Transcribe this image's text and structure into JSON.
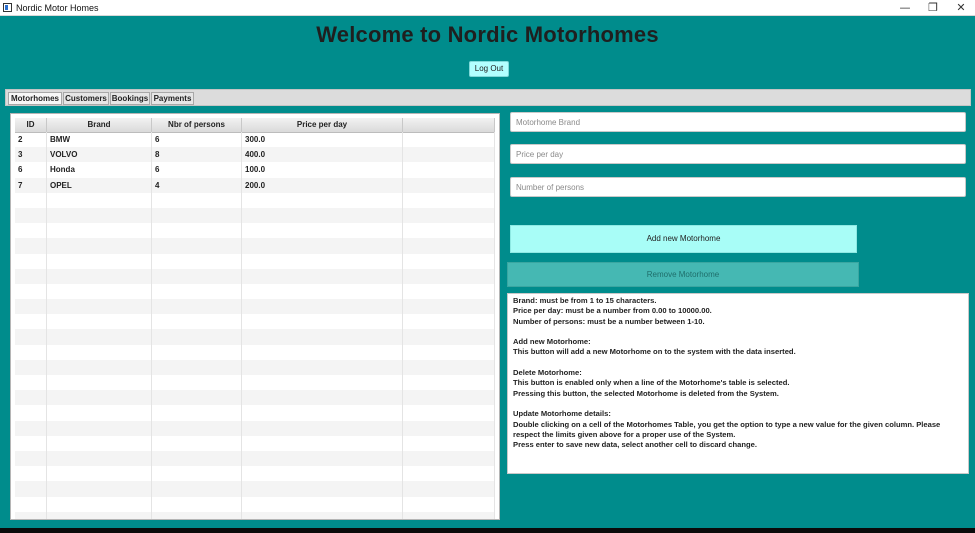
{
  "window": {
    "title": "Nordic Motor Homes",
    "minimize_glyph": "—",
    "maximize_glyph": "❐",
    "close_glyph": "✕"
  },
  "header": {
    "title": "Welcome to Nordic Motorhomes",
    "logout_label": "Log Out"
  },
  "tabs": [
    {
      "label": "Motorhomes",
      "active": true
    },
    {
      "label": "Customers",
      "active": false
    },
    {
      "label": "Bookings",
      "active": false
    },
    {
      "label": "Payments",
      "active": false
    }
  ],
  "table": {
    "columns": [
      "ID",
      "Brand",
      "Nbr of persons",
      "Price per day",
      ""
    ],
    "rows": [
      [
        "2",
        "BMW",
        "6",
        "300.0",
        ""
      ],
      [
        "3",
        "VOLVO",
        "8",
        "400.0",
        ""
      ],
      [
        "6",
        "Honda",
        "6",
        "100.0",
        ""
      ],
      [
        "7",
        "OPEL",
        "4",
        "200.0",
        ""
      ]
    ]
  },
  "form": {
    "brand_placeholder": "Motorhome Brand",
    "price_placeholder": "Price per day",
    "persons_placeholder": "Number of persons",
    "brand_value": "",
    "price_value": "",
    "persons_value": "",
    "add_label": "Add new Motorhome",
    "remove_label": "Remove Motorhome"
  },
  "info": {
    "lines": [
      "Brand: must be from 1 to 15 characters.",
      "Price per day: must be a number from 0.00 to 10000.00.",
      "Number of persons: must be a number between 1-10.",
      "",
      "Add new Motorhome:",
      "This button will add a new Motorhome on to the system with the data inserted.",
      "",
      "Delete Motorhome:",
      "This button is enabled only when a line of the Motorhome's table is selected.",
      "Pressing this button, the selected Motorhome is deleted from the System.",
      "",
      "Update Motorhome details:",
      "Double clicking on a cell of the Motorhomes Table, you get the option to type a new value for the given column. Please",
      "respect the limits given above for a proper use of the System.",
      "Press enter to save new data, select another cell to discard change."
    ]
  },
  "colors": {
    "background": "#008c8c",
    "logout_button": "#b2ffff",
    "add_button": "#a8fdf7",
    "remove_button_disabled": "#45b8b3"
  }
}
